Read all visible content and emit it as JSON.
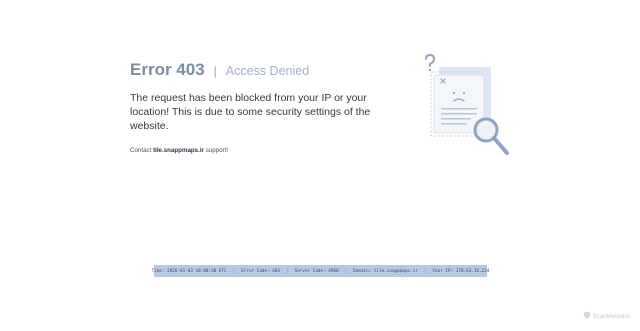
{
  "error": {
    "code_label": "Error 403",
    "divider": "|",
    "status": "Access Denied",
    "message": "The request has been blocked from your IP or your location! This is due to some security settings of the website.",
    "contact_prefix": "Contact",
    "contact_domain": "tile.snappmaps.ir",
    "contact_suffix": "support!"
  },
  "illustration": {
    "icon": "blocked-document-magnifier-icon"
  },
  "info_bar": {
    "time": "Time: 2026-01-03 18:08:38 UTC",
    "error_code": "Error Code: 403",
    "server_code": "Server Code: 4900",
    "domain": "Domain: tile.snappmaps.ir",
    "ip": "Your IP: 178.63.16.224",
    "separator": "|"
  },
  "watermark": {
    "text": "ScanMalware",
    "icon": "scanmalware-logo-icon"
  },
  "colors": {
    "error_code": "#7d8da6",
    "status": "#a3b2c8",
    "info_bar_bg": "#b8c8e4",
    "illustration": "#8fa3c4"
  }
}
